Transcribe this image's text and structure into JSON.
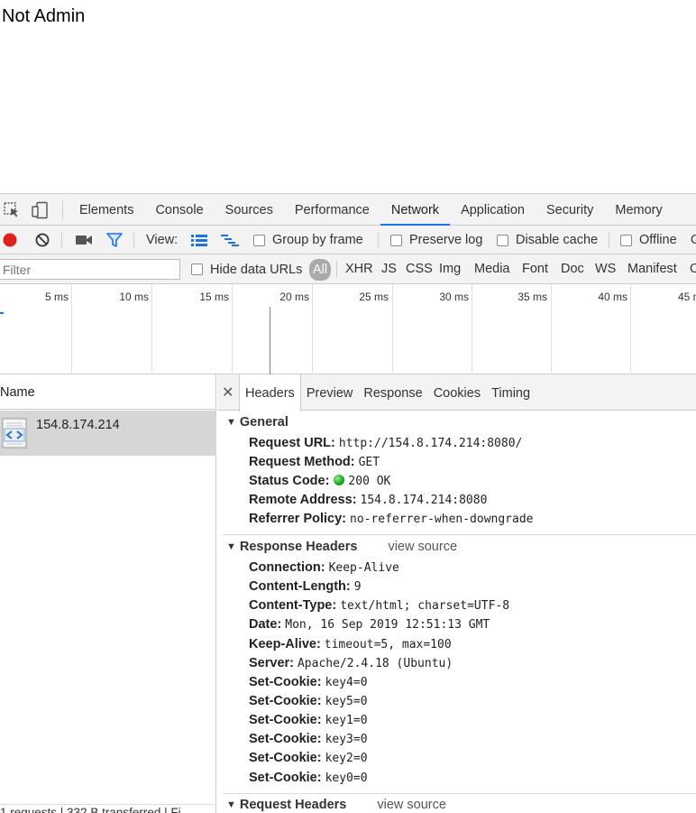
{
  "page": {
    "text": "Not Admin"
  },
  "devtools": {
    "main_tabs": [
      {
        "label": "Elements",
        "active": false
      },
      {
        "label": "Console",
        "active": false
      },
      {
        "label": "Sources",
        "active": false
      },
      {
        "label": "Performance",
        "active": false
      },
      {
        "label": "Network",
        "active": true
      },
      {
        "label": "Application",
        "active": false
      },
      {
        "label": "Security",
        "active": false
      },
      {
        "label": "Memory",
        "active": false
      }
    ],
    "toolbar": {
      "view_label": "View:",
      "group_by_frame": "Group by frame",
      "preserve_log": "Preserve log",
      "disable_cache": "Disable cache",
      "offline": "Offline",
      "overflow_char": "O"
    },
    "filter": {
      "placeholder": "Filter",
      "hide_data_urls": "Hide data URLs",
      "types": [
        "All",
        "XHR",
        "JS",
        "CSS",
        "Img",
        "Media",
        "Font",
        "Doc",
        "WS",
        "Manifest",
        "O"
      ]
    },
    "timeline": {
      "ticks": [
        "5 ms",
        "10 ms",
        "15 ms",
        "20 ms",
        "25 ms",
        "30 ms",
        "35 ms",
        "40 ms",
        "45 m"
      ]
    },
    "requests": {
      "column_name": "Name",
      "rows": [
        {
          "name": "154.8.174.214"
        }
      ],
      "status": "1 requests | 332 B transferred | Fi"
    },
    "detail": {
      "tabs": [
        {
          "label": "Headers",
          "active": true
        },
        {
          "label": "Preview",
          "active": false
        },
        {
          "label": "Response",
          "active": false
        },
        {
          "label": "Cookies",
          "active": false
        },
        {
          "label": "Timing",
          "active": false
        }
      ],
      "general": {
        "title": "General",
        "rows": [
          {
            "key": "Request URL:",
            "value": "http://154.8.174.214:8080/"
          },
          {
            "key": "Request Method:",
            "value": "GET"
          },
          {
            "key": "Status Code:",
            "value": "200 OK"
          },
          {
            "key": "Remote Address:",
            "value": "154.8.174.214:8080"
          },
          {
            "key": "Referrer Policy:",
            "value": "no-referrer-when-downgrade"
          }
        ]
      },
      "response_headers": {
        "title": "Response Headers",
        "view_source": "view source",
        "rows": [
          {
            "key": "Connection:",
            "value": "Keep-Alive"
          },
          {
            "key": "Content-Length:",
            "value": "9"
          },
          {
            "key": "Content-Type:",
            "value": "text/html; charset=UTF-8"
          },
          {
            "key": "Date:",
            "value": "Mon, 16 Sep 2019 12:51:13 GMT"
          },
          {
            "key": "Keep-Alive:",
            "value": "timeout=5, max=100"
          },
          {
            "key": "Server:",
            "value": "Apache/2.4.18 (Ubuntu)"
          },
          {
            "key": "Set-Cookie:",
            "value": "key4=0"
          },
          {
            "key": "Set-Cookie:",
            "value": "key5=0"
          },
          {
            "key": "Set-Cookie:",
            "value": "key1=0"
          },
          {
            "key": "Set-Cookie:",
            "value": "key3=0"
          },
          {
            "key": "Set-Cookie:",
            "value": "key2=0"
          },
          {
            "key": "Set-Cookie:",
            "value": "key0=0"
          }
        ]
      },
      "request_headers": {
        "title": "Request Headers",
        "view_source": "view source"
      }
    }
  }
}
